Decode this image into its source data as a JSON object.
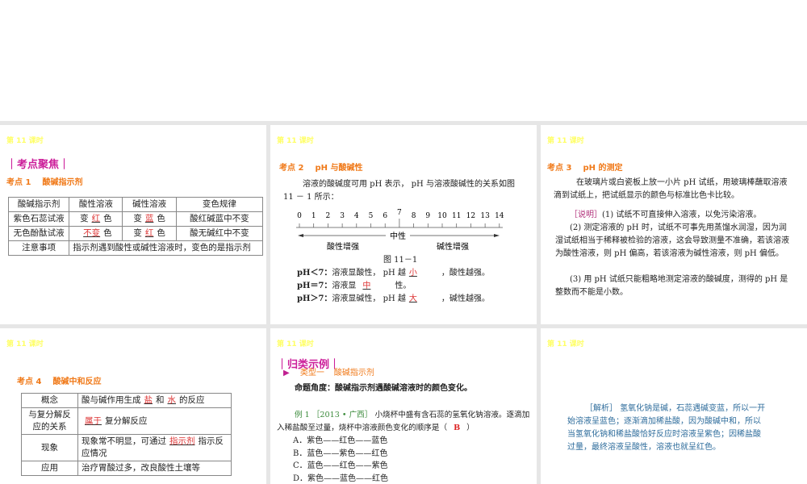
{
  "lesson": "第 11 课时",
  "s1": {
    "section": "｜考点聚焦｜",
    "kp_num": "考点 1",
    "kp_title": "酸碱指示剂",
    "headers": [
      "酸碱指示剂",
      "酸性溶液",
      "碱性溶液",
      "变色规律"
    ],
    "rows": [
      {
        "name": "紫色石蕊试液",
        "acid_pre": "变",
        "acid_ans": "红",
        "acid_post": "色",
        "base_pre": "变",
        "base_ans": "蓝",
        "base_post": "色",
        "rule": "酸红碱蓝中不变"
      },
      {
        "name": "无色酚酞试液",
        "acid_pre": "",
        "acid_ans": "不变",
        "acid_post": "色",
        "base_pre": "变",
        "base_ans": "红",
        "base_post": "色",
        "rule": "酸无碱红中不变"
      }
    ],
    "note_label": "注意事项",
    "note": "指示剂遇到酸性或碱性溶液时，变色的是指示剂"
  },
  "s2": {
    "kp_num": "考点 2",
    "kp_title": "pH 与酸碱性",
    "intro": "溶液的酸碱度可用 pH 表示， pH 与溶液酸碱性的关系如图 11 － 1 所示：",
    "scale": [
      "0",
      "1",
      "2",
      "3",
      "4",
      "5",
      "6",
      "7",
      "8",
      "9",
      "10",
      "11",
      "12",
      "13",
      "14"
    ],
    "neutral": "中性",
    "acid_label": "酸性增强",
    "base_label": "碱性增强",
    "caption": "图 11－1",
    "lines": [
      {
        "cond": "pH＜7：",
        "text": "溶液显酸性， pH 越",
        "ans": "小",
        "tail": "，酸性越强。"
      },
      {
        "cond": "pH＝7：",
        "text": "溶液显",
        "ans": "中",
        "tail": "性。"
      },
      {
        "cond": "pH＞7：",
        "text": "溶液显碱性， pH 越",
        "ans": "大",
        "tail": "，碱性越强。"
      }
    ]
  },
  "s3": {
    "kp_num": "考点 3",
    "kp_title": "pH 的测定",
    "intro": "在玻璃片或白瓷板上放一小片 pH 试纸，用玻璃棒蘸取溶液滴到试纸上，把试纸显示的颜色与标准比色卡比较。",
    "note_tag": "［说明］",
    "note1": "(1) 试纸不可直接伸入溶液，以免污染溶液。",
    "note2": "(2) 测定溶液的 pH 时，试纸不可事先用蒸馏水润湿，因为润湿试纸相当于稀释被检验的溶液，这会导致测量不准确，若该溶液为酸性溶液，则 pH 偏高，若该溶液为碱性溶液，则 pH 偏低。",
    "note3": "(3) 用 pH 试纸只能粗略地测定溶液的酸碱度，测得的 pH 是整数而不能是小数。"
  },
  "s4": {
    "kp_num": "考点 4",
    "kp_title": "酸碱中和反应",
    "r1_label": "概念",
    "r1_a": "酸与碱作用生成",
    "r1_ans1": "盐",
    "r1_b": "和",
    "r1_ans2": "水",
    "r1_c": "的反应",
    "r2_label": "与复分解反应的关系",
    "r2_ans": "属于",
    "r2_text": "复分解反应",
    "r3_label": "现象",
    "r3_a": "现象常不明显，可通过",
    "r3_ans": "指示剂",
    "r3_b": "指示反应情况",
    "r4_label": "应用",
    "r4_text": "治疗胃酸过多，改良酸性土壤等"
  },
  "s5": {
    "section": "｜归类示例｜",
    "type_label": "类型一",
    "type_title": "酸碱指示剂",
    "angle": "命题角度：酸碱指示剂遇酸碱溶液时的颜色变化。",
    "ex_label": "例 1",
    "ex_src": "［2013 • 广西］",
    "question": "小烧杯中盛有含石蕊的氢氧化钠溶液。逐滴加入稀盐酸至过量，烧杯中溶液颜色变化的顺序是（",
    "answer": "B",
    "q_end": "）",
    "options": [
      "A．紫色——红色——蓝色",
      "B．蓝色——紫色——红色",
      "C．蓝色——红色——紫色",
      "D．紫色——蓝色——红色"
    ]
  },
  "s6": {
    "tag": "［解析］",
    "text": "氢氧化钠是碱，石蕊遇碱变蓝，所以一开始溶液呈蓝色；逐渐滴加稀盐酸，因为酸碱中和，所以当氢氧化钠和稀盐酸恰好反应时溶液呈紫色；因稀盐酸过量，最终溶液呈酸性，溶液也就呈红色。"
  }
}
